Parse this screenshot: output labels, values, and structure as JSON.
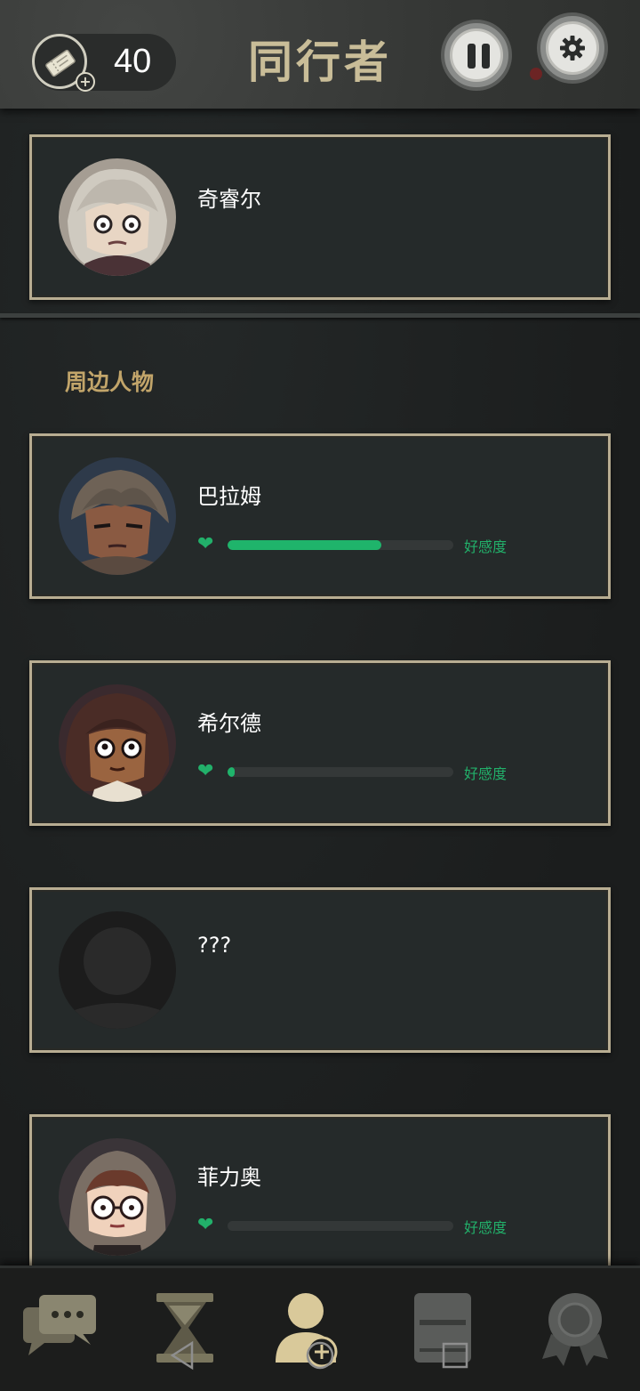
{
  "header": {
    "title": "同行者",
    "tickets": "40",
    "ticket_plus": "+"
  },
  "companion": {
    "name": "奇睿尔"
  },
  "section": {
    "label": "周边人物"
  },
  "characters": [
    {
      "name": "巴拉姆",
      "affinity_label": "好感度",
      "affinity": 0.68
    },
    {
      "name": "希尔德",
      "affinity_label": "好感度",
      "affinity": 0.03
    },
    {
      "name": "???"
    },
    {
      "name": "菲力奥",
      "affinity_label": "好感度",
      "affinity": 0.0
    }
  ],
  "nav": {
    "items": [
      "chat-icon",
      "hourglass-icon",
      "companions-icon",
      "journal-icon",
      "achievements-icon"
    ],
    "active": "companions-icon"
  },
  "colors": {
    "accent_gold": "#c9bd98",
    "affinity_green": "#1fb46b",
    "card_border": "#b8ad92",
    "section_label": "#c2a56a"
  }
}
